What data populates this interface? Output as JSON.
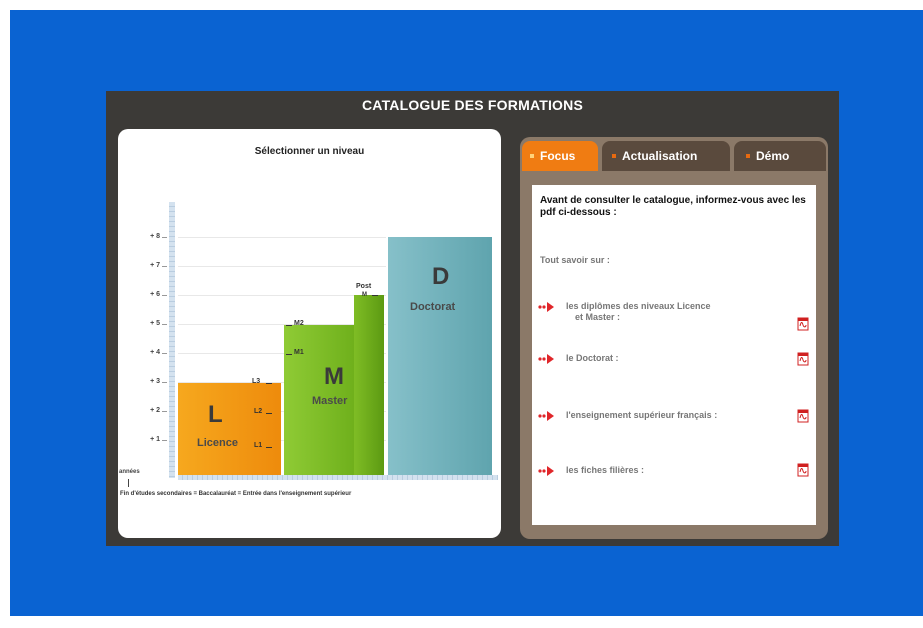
{
  "title": "CATALOGUE DES FORMATIONS",
  "chart": {
    "heading": "Sélectionner un niveau",
    "ticks": [
      "+ 8",
      "+ 7",
      "+ 6",
      "+ 5",
      "+ 4",
      "+ 3",
      "+ 2",
      "+ 1"
    ],
    "years_label": "années",
    "footnote": "Fin d'études secondaires = Baccalauréat = Entrée dans l'enseignement supérieur",
    "licence": {
      "letter": "L",
      "name": "Licence",
      "color": "#f29a17",
      "subs": [
        "L3",
        "L2",
        "L1"
      ]
    },
    "master": {
      "letter": "M",
      "name": "Master",
      "color": "#7fbd25",
      "subs": [
        "M2",
        "M1"
      ],
      "post_line1": "Post",
      "post_line2": "M"
    },
    "doctorat": {
      "letter": "D",
      "name": "Doctorat",
      "color": "#6fb0ba"
    }
  },
  "chart_data": {
    "type": "bar",
    "categories": [
      "Licence",
      "Master",
      "Post M",
      "Doctorat"
    ],
    "values": [
      3,
      5,
      6,
      8
    ],
    "ylabel": "années",
    "ylim": [
      0,
      8
    ]
  },
  "tabs": [
    {
      "label": "Focus",
      "active": true
    },
    {
      "label": "Actualisation",
      "active": false
    },
    {
      "label": "Démo",
      "active": false
    }
  ],
  "focus": {
    "intro": "Avant de consulter le catalogue, informez-vous avec les pdf ci-dessous :",
    "subhead": "Tout savoir sur :",
    "items": [
      {
        "line1": "les diplômes des niveaux Licence",
        "line2": "et Master :"
      },
      {
        "line1": "le Doctorat :",
        "line2": ""
      },
      {
        "line1": "l'enseignement supérieur français :",
        "line2": ""
      },
      {
        "line1": "les fiches filières :",
        "line2": ""
      }
    ]
  },
  "colors": {
    "background": "#0a63d2",
    "frame": "#3c3a37",
    "tab_active": "#f07c12",
    "tab_inactive": "#5a4a3d",
    "right_panel": "#8b7968",
    "bullet": "#e0262a"
  },
  "icons": {
    "bullet": "double-arrow-icon",
    "document": "pdf-icon"
  }
}
